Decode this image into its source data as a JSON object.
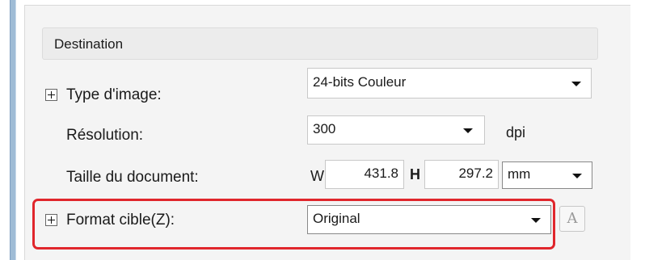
{
  "destination": {
    "header": "Destination",
    "image_type": {
      "label": "Type d'image:",
      "value": "24-bits Couleur"
    },
    "resolution": {
      "label": "Résolution:",
      "value": "300",
      "unit": "dpi"
    },
    "document_size": {
      "label": "Taille du document:",
      "width_prefix": "W",
      "width": "431.8",
      "height_prefix": "H",
      "height": "297.2",
      "unit": "mm"
    },
    "target_format": {
      "label": "Format cible(Z):",
      "value": "Original",
      "lock_button": "A"
    }
  }
}
